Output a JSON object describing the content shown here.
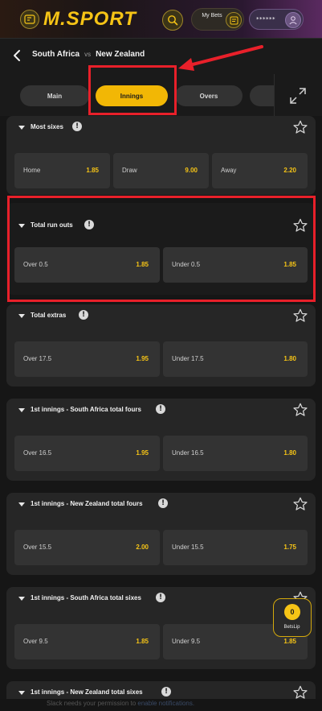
{
  "header": {
    "logo_text": "M.SPORT",
    "mybets_label": "My Bets",
    "account_mask": "******"
  },
  "match": {
    "home": "South Africa",
    "vs": "vs",
    "away": "New Zealand"
  },
  "tabs": [
    {
      "label": "Main",
      "active": false
    },
    {
      "label": "Innings",
      "active": true
    },
    {
      "label": "Overs",
      "active": false
    }
  ],
  "markets": [
    {
      "title": "Most sixes",
      "outcomes": [
        {
          "label": "Home",
          "odds": "1.85"
        },
        {
          "label": "Draw",
          "odds": "9.00"
        },
        {
          "label": "Away",
          "odds": "2.20"
        }
      ]
    },
    {
      "title": "Total run outs",
      "outcomes": [
        {
          "label": "Over 0.5",
          "odds": "1.85"
        },
        {
          "label": "Under 0.5",
          "odds": "1.85"
        }
      ]
    },
    {
      "title": "Total extras",
      "outcomes": [
        {
          "label": "Over 17.5",
          "odds": "1.95"
        },
        {
          "label": "Under 17.5",
          "odds": "1.80"
        }
      ]
    },
    {
      "title": "1st innings - South Africa total fours",
      "outcomes": [
        {
          "label": "Over 16.5",
          "odds": "1.95"
        },
        {
          "label": "Under 16.5",
          "odds": "1.80"
        }
      ]
    },
    {
      "title": "1st innings - New Zealand total fours",
      "outcomes": [
        {
          "label": "Over 15.5",
          "odds": "2.00"
        },
        {
          "label": "Under 15.5",
          "odds": "1.75"
        }
      ]
    },
    {
      "title": "1st innings - South Africa total sixes",
      "outcomes": [
        {
          "label": "Over 9.5",
          "odds": "1.85"
        },
        {
          "label": "Under 9.5",
          "odds": "1.85"
        }
      ]
    },
    {
      "title": "1st innings - New Zealand total sixes",
      "outcomes": []
    }
  ],
  "betslip": {
    "count": "0",
    "label": "BetsLip"
  },
  "notification": {
    "text": "Slack needs your permission to ",
    "link": "enable notifications."
  },
  "colors": {
    "accent": "#f6c416",
    "highlight": "#e8202a",
    "card": "#262626",
    "odd_button": "#333333"
  }
}
